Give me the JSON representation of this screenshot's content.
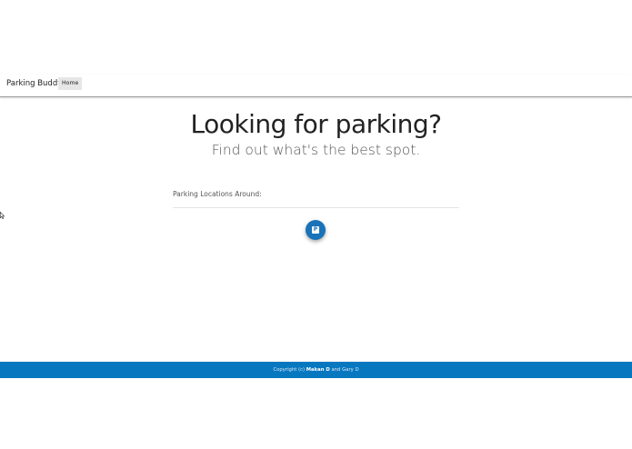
{
  "navbar": {
    "brand": "Parking Buddy",
    "items": [
      {
        "label": "Home",
        "active": true
      }
    ]
  },
  "hero": {
    "title": "Looking for parking?",
    "subtitle": "Find out what's the best spot."
  },
  "locations": {
    "label": "Parking Locations Around:"
  },
  "fab": {
    "icon": "parking-icon",
    "glyph": "P"
  },
  "footer": {
    "copyright_prefix": "Copyright (c)",
    "author_1": "Makan D",
    "joiner": "and",
    "author_2": "Gary D"
  },
  "colors": {
    "accent": "#1a72b8",
    "footer_bg": "#0778c0",
    "nav_active_bg": "#e6e6e6"
  }
}
